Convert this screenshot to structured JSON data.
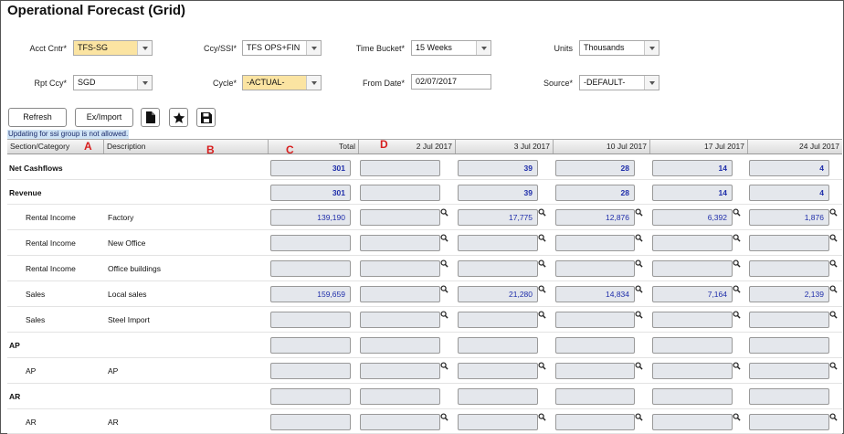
{
  "title": "Operational Forecast (Grid)",
  "filters": {
    "acct_cntr": {
      "label": "Acct Cntr*",
      "value": "TFS-SG"
    },
    "ccy_ssi": {
      "label": "Ccy/SSI*",
      "value": "TFS OPS+FIN"
    },
    "time_bucket": {
      "label": "Time Bucket*",
      "value": "15 Weeks"
    },
    "units": {
      "label": "Units",
      "value": "Thousands"
    },
    "rpt_ccy": {
      "label": "Rpt Ccy*",
      "value": "SGD"
    },
    "cycle": {
      "label": "Cycle*",
      "value": "-ACTUAL-"
    },
    "from_date": {
      "label": "From Date*",
      "value": "02/07/2017"
    },
    "source": {
      "label": "Source*",
      "value": "-DEFAULT-"
    }
  },
  "toolbar": {
    "refresh": "Refresh",
    "ex_import": "Ex/Import"
  },
  "notice": "Updating for ssi group is not allowed.",
  "headers": {
    "section": "Section/Category",
    "description": "Description",
    "total": "Total",
    "dates": [
      "2 Jul 2017",
      "3 Jul 2017",
      "10 Jul 2017",
      "17 Jul 2017",
      "24 Jul 2017"
    ]
  },
  "markers": {
    "a": "A",
    "b": "B",
    "c": "C",
    "d": "D"
  },
  "rows": [
    {
      "section": "Net Cashflows",
      "description": "",
      "total": "301",
      "values": [
        "",
        "39",
        "28",
        "14",
        "4"
      ]
    },
    {
      "section": "Revenue",
      "description": "",
      "total": "301",
      "values": [
        "",
        "39",
        "28",
        "14",
        "4"
      ]
    },
    {
      "section": "Rental Income",
      "description": "Factory",
      "total": "139,190",
      "values": [
        "",
        "17,775",
        "12,876",
        "6,392",
        "1,876"
      ]
    },
    {
      "section": "Rental Income",
      "description": "New Office",
      "total": "",
      "values": [
        "",
        "",
        "",
        "",
        ""
      ]
    },
    {
      "section": "Rental Income",
      "description": "Office buildings",
      "total": "",
      "values": [
        "",
        "",
        "",
        "",
        ""
      ]
    },
    {
      "section": "Sales",
      "description": "Local sales",
      "total": "159,659",
      "values": [
        "",
        "21,280",
        "14,834",
        "7,164",
        "2,139"
      ]
    },
    {
      "section": "Sales",
      "description": "Steel Import",
      "total": "",
      "values": [
        "",
        "",
        "",
        "",
        ""
      ]
    },
    {
      "section": "AP",
      "description": "",
      "total": "",
      "values": [
        "",
        "",
        "",
        "",
        ""
      ]
    },
    {
      "section": "AP",
      "description": "AP",
      "total": "",
      "values": [
        "",
        "",
        "",
        "",
        ""
      ]
    },
    {
      "section": "AR",
      "description": "",
      "total": "",
      "values": [
        "",
        "",
        "",
        "",
        ""
      ]
    },
    {
      "section": "AR",
      "description": "AR",
      "total": "",
      "values": [
        "",
        "",
        "",
        "",
        ""
      ]
    }
  ]
}
